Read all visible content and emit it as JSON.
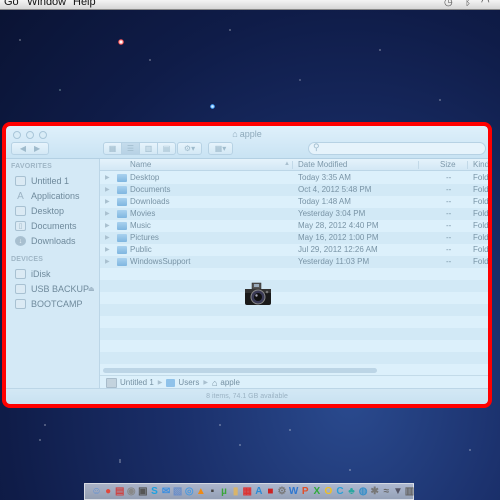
{
  "menubar": {
    "menus": [
      "Go",
      "Window",
      "Help"
    ],
    "status_icons": [
      "time-machine-icon",
      "bluetooth-icon",
      "wifi-icon"
    ]
  },
  "window": {
    "title": "apple",
    "toolbar": {
      "back_label": "◀",
      "forward_label": "▶",
      "view_modes": [
        "icon-view",
        "list-view",
        "column-view",
        "cover-flow-view"
      ],
      "active_view": "list-view",
      "action_label": "⚙▾",
      "arrange_label": "▦▾",
      "search_placeholder": ""
    },
    "sidebar": {
      "favorites_header": "FAVORITES",
      "favorites": [
        {
          "label": "Untitled 1",
          "icon": "disk-icon"
        },
        {
          "label": "Applications",
          "icon": "applications-icon"
        },
        {
          "label": "Desktop",
          "icon": "desktop-icon"
        },
        {
          "label": "Documents",
          "icon": "documents-icon"
        },
        {
          "label": "Downloads",
          "icon": "downloads-icon"
        }
      ],
      "devices_header": "DEVICES",
      "devices": [
        {
          "label": "iDisk",
          "icon": "idisk-icon"
        },
        {
          "label": "USB BACKUP",
          "icon": "usb-drive-icon",
          "ejectable": true
        },
        {
          "label": "BOOTCAMP",
          "icon": "disk-icon"
        }
      ]
    },
    "columns": {
      "name": "Name",
      "date": "Date Modified",
      "size": "Size",
      "kind": "Kind"
    },
    "files": [
      {
        "name": "Desktop",
        "date": "Today 3:35 AM",
        "size": "--",
        "kind": "Fold"
      },
      {
        "name": "Documents",
        "date": "Oct 4, 2012 5:48 PM",
        "size": "--",
        "kind": "Fold"
      },
      {
        "name": "Downloads",
        "date": "Today 1:48 AM",
        "size": "--",
        "kind": "Fold"
      },
      {
        "name": "Movies",
        "date": "Yesterday 3:04 PM",
        "size": "--",
        "kind": "Fold"
      },
      {
        "name": "Music",
        "date": "May 28, 2012 4:40 PM",
        "size": "--",
        "kind": "Fold"
      },
      {
        "name": "Pictures",
        "date": "May 16, 2012 1:00 PM",
        "size": "--",
        "kind": "Fold"
      },
      {
        "name": "Public",
        "date": "Jul 29, 2012 12:26 AM",
        "size": "--",
        "kind": "Fold"
      },
      {
        "name": "WindowsSupport",
        "date": "Yesterday 11:03 PM",
        "size": "--",
        "kind": "Fold"
      }
    ],
    "pathbar": [
      "Untitled 1",
      "Users",
      "apple"
    ],
    "status": "8 items, 74.1 GB available"
  },
  "dock": {
    "icons": [
      {
        "name": "finder",
        "glyph": "☺",
        "color": "#5b8fd6"
      },
      {
        "name": "chrome",
        "glyph": "●",
        "color": "#e0483b"
      },
      {
        "name": "clapper",
        "glyph": "▤",
        "color": "#c44"
      },
      {
        "name": "aperture",
        "glyph": "◉",
        "color": "#888"
      },
      {
        "name": "photo-booth",
        "glyph": "▣",
        "color": "#555"
      },
      {
        "name": "skype",
        "glyph": "S",
        "color": "#1da1e0"
      },
      {
        "name": "mail",
        "glyph": "✉",
        "color": "#3a8ee0"
      },
      {
        "name": "preview",
        "glyph": "▧",
        "color": "#6a8ec9"
      },
      {
        "name": "safari",
        "glyph": "◎",
        "color": "#4a9ae0"
      },
      {
        "name": "vlc",
        "glyph": "▲",
        "color": "#f08a12"
      },
      {
        "name": "facetime",
        "glyph": "▪",
        "color": "#444"
      },
      {
        "name": "utorrent",
        "glyph": "µ",
        "color": "#3aa53a"
      },
      {
        "name": "notes",
        "glyph": "▮",
        "color": "#d9b46a"
      },
      {
        "name": "calendar",
        "glyph": "▦",
        "color": "#d33"
      },
      {
        "name": "app-store",
        "glyph": "A",
        "color": "#2b8bd6"
      },
      {
        "name": "photo-app",
        "glyph": "■",
        "color": "#c22"
      },
      {
        "name": "system-preferences",
        "glyph": "⚙",
        "color": "#777"
      },
      {
        "name": "word",
        "glyph": "W",
        "color": "#2f77d0"
      },
      {
        "name": "powerpoint",
        "glyph": "P",
        "color": "#e0502a"
      },
      {
        "name": "excel",
        "glyph": "X",
        "color": "#2faa3a"
      },
      {
        "name": "outlook",
        "glyph": "O",
        "color": "#f0c020"
      },
      {
        "name": "communicator",
        "glyph": "C",
        "color": "#2aa0d8"
      },
      {
        "name": "messenger",
        "glyph": "♣",
        "color": "#2aa8a0"
      },
      {
        "name": "globe",
        "glyph": "◍",
        "color": "#3a90c9"
      },
      {
        "name": "network-utility",
        "glyph": "✱",
        "color": "#777"
      },
      {
        "name": "audio",
        "glyph": "≈",
        "color": "#666"
      },
      {
        "name": "downloads-stack",
        "glyph": "▼",
        "color": "#556"
      },
      {
        "name": "trash",
        "glyph": "▥",
        "color": "#666"
      }
    ]
  }
}
